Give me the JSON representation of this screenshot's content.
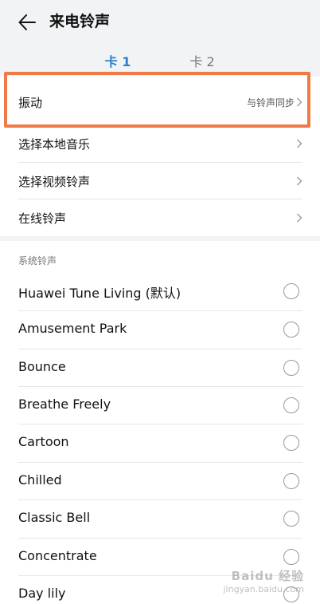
{
  "header": {
    "title": "来电铃声"
  },
  "tabs": [
    {
      "label": "卡 1"
    },
    {
      "label": "卡 2"
    }
  ],
  "settings": {
    "vibration": {
      "label": "振动",
      "value": "与铃声同步"
    },
    "local_music": {
      "label": "选择本地音乐"
    },
    "video_ringtone": {
      "label": "选择视频铃声"
    },
    "online_ringtone": {
      "label": "在线铃声"
    }
  },
  "system_ringtones": {
    "title": "系统铃声",
    "items": [
      {
        "label": "Huawei Tune Living (默认)"
      },
      {
        "label": "Amusement Park"
      },
      {
        "label": "Bounce"
      },
      {
        "label": "Breathe Freely"
      },
      {
        "label": "Cartoon"
      },
      {
        "label": "Chilled"
      },
      {
        "label": "Classic Bell"
      },
      {
        "label": "Concentrate"
      },
      {
        "label": "Day lily"
      }
    ]
  },
  "colors": {
    "accent": "#2f7fd1",
    "highlight": "#ef7a47"
  },
  "watermark": {
    "brand": "Baidu 经验",
    "url": "jingyan.baidu.com"
  }
}
